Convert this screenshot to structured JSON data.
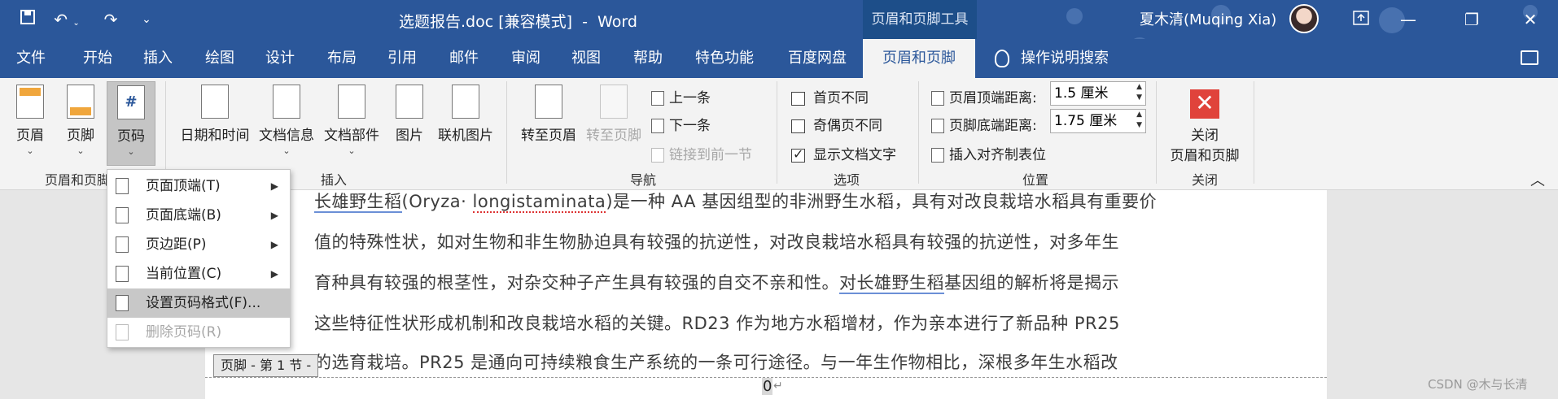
{
  "titlebar": {
    "title": "选题报告.doc [兼容模式]  -  Word",
    "tools_tab": "页眉和页脚工具",
    "user": "夏木清(Muqing Xia)",
    "icons": [
      "save-icon",
      "undo-icon",
      "redo-icon",
      "customize-icon"
    ]
  },
  "tabs": [
    "文件",
    "开始",
    "插入",
    "绘图",
    "设计",
    "布局",
    "引用",
    "邮件",
    "审阅",
    "视图",
    "帮助",
    "特色功能",
    "百度网盘",
    "页眉和页脚"
  ],
  "search_label": "操作说明搜索",
  "ribbon": {
    "header_footer_group": {
      "header": "页眉",
      "footer": "页脚",
      "page_number": "页码",
      "label": "页眉和页脚"
    },
    "insert_group": {
      "date_time": "日期和时间",
      "doc_info": "文档信息",
      "doc_parts": "文档部件",
      "pictures": "图片",
      "online_pictures": "联机图片",
      "label": "插入"
    },
    "nav_group": {
      "goto_header": "转至页眉",
      "goto_footer": "转至页脚",
      "previous": "上一条",
      "next": "下一条",
      "link_previous": "链接到前一节",
      "label": "导航"
    },
    "options_group": {
      "different_first": "首页不同",
      "different_odd_even": "奇偶页不同",
      "show_doc_text": "显示文档文字",
      "label": "选项"
    },
    "position_group": {
      "header_top_label": "页眉顶端距离:",
      "header_top_value": "1.5 厘米",
      "footer_bottom_label": "页脚底端距离:",
      "footer_bottom_value": "1.75 厘米",
      "insert_align_tab": "插入对齐制表位",
      "label": "位置"
    },
    "close_group": {
      "close_line1": "关闭",
      "close_line2": "页眉和页脚",
      "label": "关闭"
    }
  },
  "dropdown": {
    "items": [
      {
        "label": "页面顶端(T)",
        "has_submenu": true
      },
      {
        "label": "页面底端(B)",
        "has_submenu": true
      },
      {
        "label": "页边距(P)",
        "has_submenu": true
      },
      {
        "label": "当前位置(C)",
        "has_submenu": true
      },
      {
        "label": "设置页码格式(F)...",
        "has_submenu": false
      },
      {
        "label": "删除页码(R)",
        "has_submenu": false
      }
    ]
  },
  "document": {
    "line1_a": "长雄野生稻",
    "line1_b": "(Oryza· ",
    "line1_c": "longistaminata",
    "line1_d": ")是一种 AA 基因组型的非洲野生水稻，具有对改良栽培水稻具有重要价",
    "line2": "值的特殊性状，如对生物和非生物胁迫具有较强的抗逆性，对改良栽培水稻具有较强的抗逆性，对多年生",
    "line3_a": "育种具有较强的根茎性，对杂交种子产生具有较强的自交不亲和性。",
    "line3_b": "对长雄野生稻",
    "line3_c": "基因组的解析将是揭示",
    "line4": "这些特征性状形成机制和改良栽培水稻的关键。RD23  作为地方水稻增材，作为亲本进行了新品种  PR25",
    "line5": "的选育栽培。PR25  是通向可持续粮食生产系统的一条可行途径。与一年生作物相比，深根多年生水稻改",
    "footer_tag": "页脚 - 第 1 节 -",
    "page_number": "0",
    "return_mark": "↵"
  },
  "watermark": "CSDN @木与长清"
}
